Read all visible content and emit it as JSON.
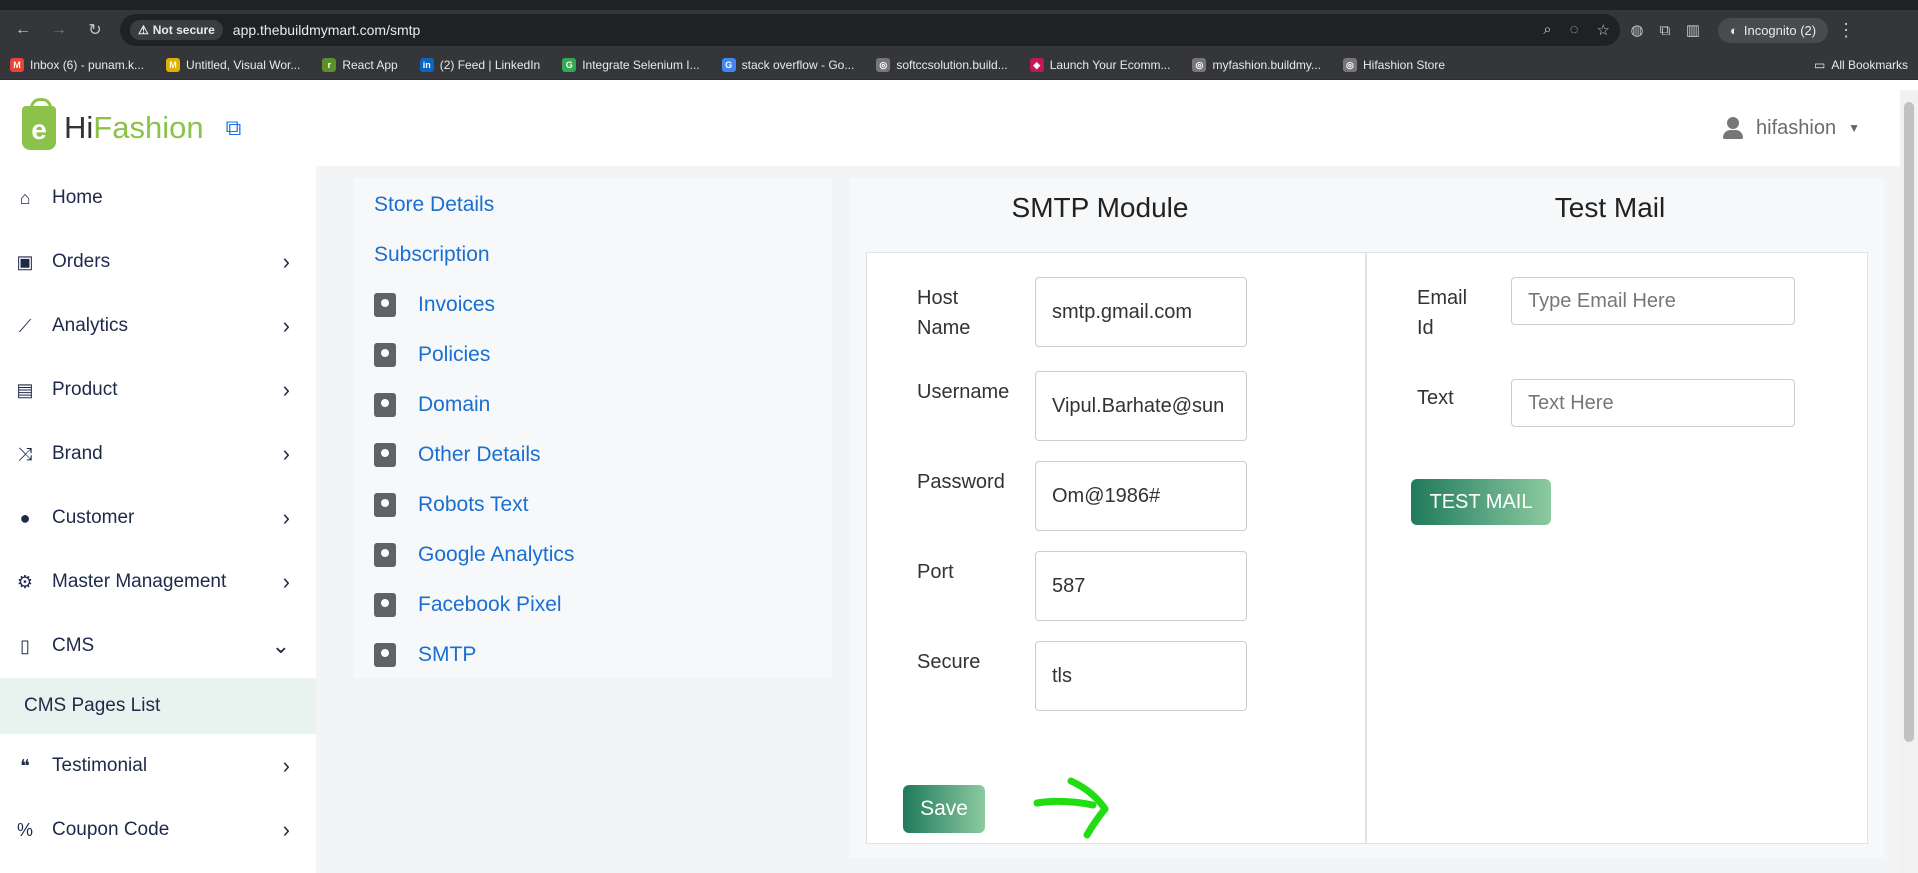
{
  "browser": {
    "not_secure": "Not secure",
    "url": "app.thebuildmymart.com/smtp",
    "incognito": "Incognito (2)",
    "bookmarks": [
      {
        "label": "Inbox (6) - punam.k...",
        "color": "#ea4335",
        "glyph": "M"
      },
      {
        "label": "Untitled, Visual Wor...",
        "color": "#e2b000",
        "glyph": "M"
      },
      {
        "label": "React App",
        "color": "#5a8f29",
        "glyph": "r"
      },
      {
        "label": "(2) Feed | LinkedIn",
        "color": "#0a66c2",
        "glyph": "in"
      },
      {
        "label": "Integrate Selenium I...",
        "color": "#34a853",
        "glyph": "G"
      },
      {
        "label": "stack overflow - Go...",
        "color": "#4285f4",
        "glyph": "G"
      },
      {
        "label": "softccsolution.build...",
        "color": "#777777",
        "glyph": "◎"
      },
      {
        "label": "Launch Your Ecomm...",
        "color": "#c2185b",
        "glyph": "◈"
      },
      {
        "label": "myfashion.buildmy...",
        "color": "#777777",
        "glyph": "◎"
      },
      {
        "label": "Hifashion Store",
        "color": "#777777",
        "glyph": "◎"
      }
    ],
    "all_bookmarks": "All Bookmarks"
  },
  "header": {
    "logo_hi": "Hi",
    "logo_fashion": "Fashion",
    "logo_letter": "e",
    "user": "hifashion"
  },
  "sidebar": {
    "items": [
      {
        "label": "Home",
        "icon": "⌂",
        "chevron": ""
      },
      {
        "label": "Orders",
        "icon": "▣",
        "chevron": "›"
      },
      {
        "label": "Analytics",
        "icon": "⟋",
        "chevron": "›"
      },
      {
        "label": "Product",
        "icon": "▤",
        "chevron": "›"
      },
      {
        "label": "Brand",
        "icon": "⤨",
        "chevron": "›"
      },
      {
        "label": "Customer",
        "icon": "●",
        "chevron": "›"
      },
      {
        "label": "Master Management",
        "icon": "⚙",
        "chevron": "›"
      },
      {
        "label": "CMS",
        "icon": "▯",
        "chevron": "⌄"
      }
    ],
    "sub_item": "CMS Pages List",
    "items_after": [
      {
        "label": "Testimonial",
        "icon": "❝",
        "chevron": "›"
      },
      {
        "label": "Coupon Code",
        "icon": "%",
        "chevron": "›"
      }
    ]
  },
  "settings_nav": {
    "plain": [
      "Store Details",
      "Subscription"
    ],
    "with_icon": [
      "Invoices",
      "Policies",
      "Domain",
      "Other Details",
      "Robots Text",
      "Google Analytics",
      "Facebook Pixel",
      "SMTP"
    ]
  },
  "smtp": {
    "title": "SMTP Module",
    "host_label": "Host Name",
    "host_value": "smtp.gmail.com",
    "username_label": "Username",
    "username_value": "Vipul.Barhate@sun",
    "password_label": "Password",
    "password_value": "Om@1986#",
    "port_label": "Port",
    "port_value": "587",
    "secure_label": "Secure",
    "secure_value": "tls",
    "save_label": "Save"
  },
  "test_mail": {
    "title": "Test Mail",
    "email_label": "Email Id",
    "email_placeholder": "Type Email Here",
    "text_label": "Text",
    "text_placeholder": "Text Here",
    "button_label": "TEST MAIL"
  },
  "colors": {
    "accent_green": "#1f7a5c",
    "link_blue": "#1a6fd0",
    "annotation_arrow": "#22dd11"
  }
}
